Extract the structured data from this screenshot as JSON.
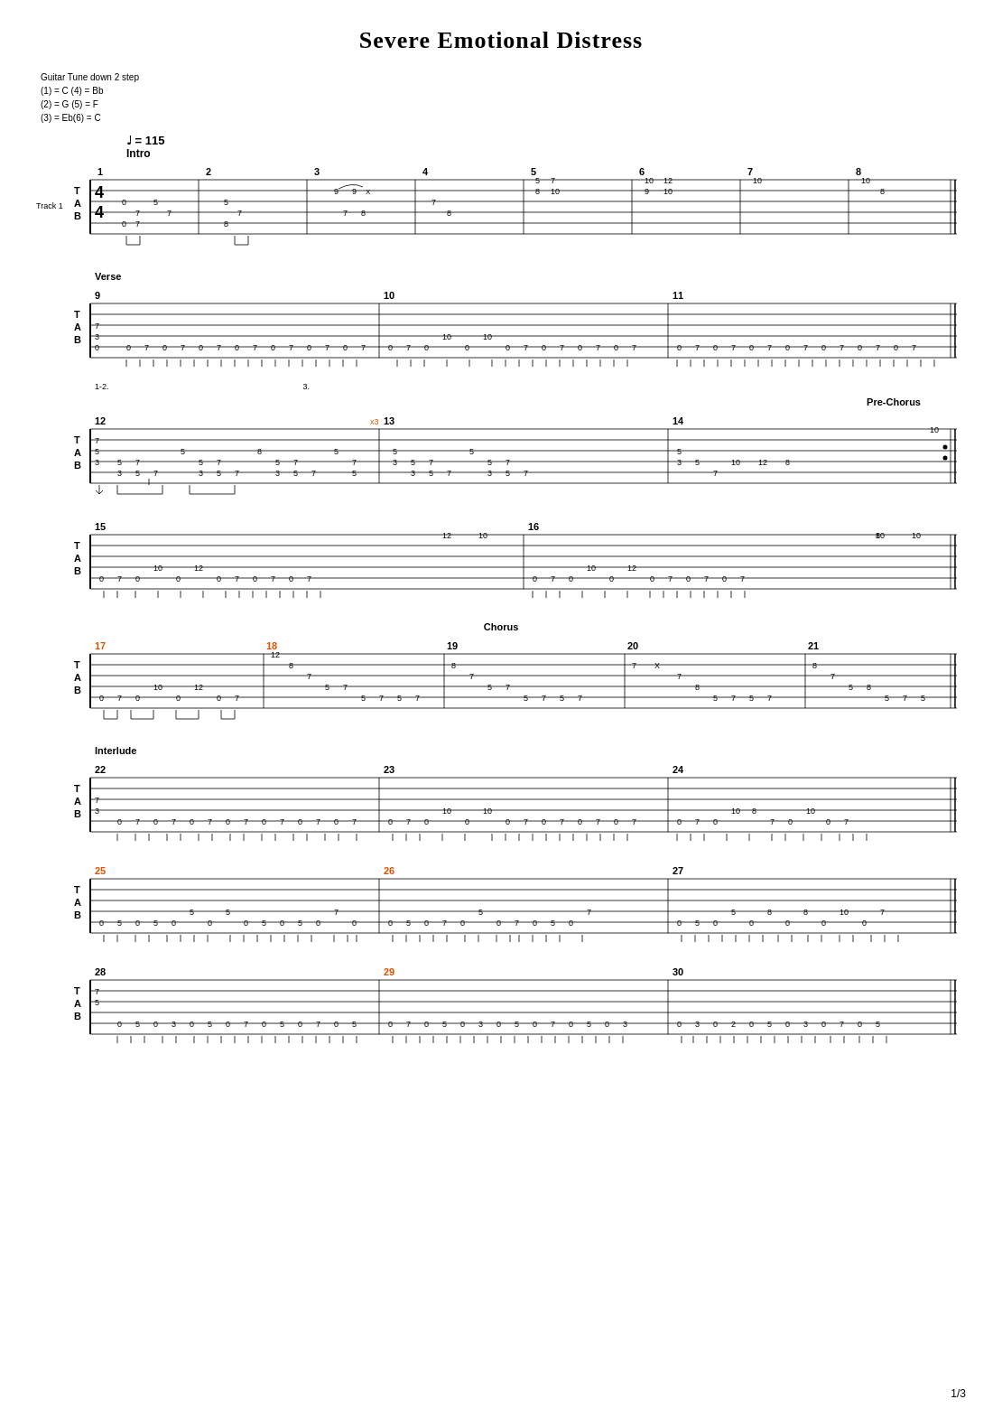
{
  "title": "Severe Emotional Distress",
  "tuning": {
    "line1": "Guitar Tune down 2 step",
    "line2": "(1) = C (4) = Bb",
    "line3": "(2) = G (5) = F",
    "line4": "(3) = Eb(6) = C"
  },
  "tempo": "♩ = 115",
  "sections": {
    "intro": "Intro",
    "verse": "Verse",
    "preChorus": "Pre-Chorus",
    "chorus": "Chorus",
    "interlude": "Interlude"
  },
  "pageNumber": "1/3"
}
